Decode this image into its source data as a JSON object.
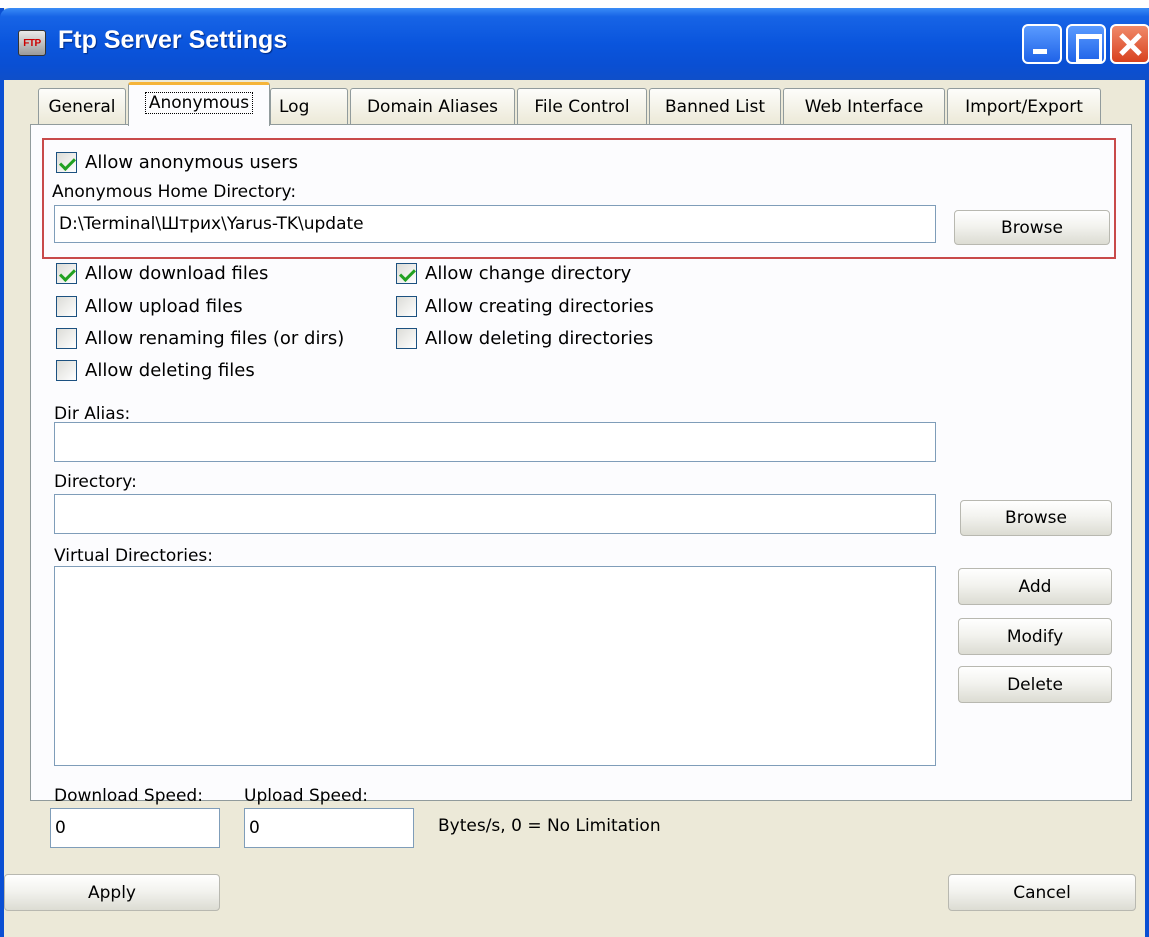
{
  "window": {
    "title": "Ftp Server Settings",
    "icon_text": "FTP"
  },
  "tabs": [
    {
      "label": "General"
    },
    {
      "label": "Anonymous"
    },
    {
      "label": "Log"
    },
    {
      "label": "Domain Aliases"
    },
    {
      "label": "File Control"
    },
    {
      "label": "Banned List"
    },
    {
      "label": "Web Interface"
    },
    {
      "label": "Import/Export"
    }
  ],
  "anonymous": {
    "allow_anonymous_label": "Allow anonymous users",
    "home_dir_label": "Anonymous Home Directory:",
    "home_dir_value": "D:\\Terminal\\Штрих\\Yarus-TK\\update",
    "browse_label": "Browse"
  },
  "permissions": {
    "download": "Allow download files",
    "upload": "Allow upload files",
    "renaming": "Allow renaming files (or dirs)",
    "deleting_files": "Allow deleting files",
    "change_dir": "Allow change directory",
    "creating_dirs": "Allow creating directories",
    "deleting_dirs": "Allow deleting directories"
  },
  "virtual": {
    "dir_alias_label": "Dir Alias:",
    "directory_label": "Directory:",
    "browse_label": "Browse",
    "list_label": "Virtual Directories:",
    "add_label": "Add",
    "modify_label": "Modify",
    "delete_label": "Delete"
  },
  "speed": {
    "download_label": "Download Speed:",
    "download_value": "0",
    "upload_label": "Upload Speed:",
    "upload_value": "0",
    "note": "Bytes/s, 0 = No Limitation"
  },
  "footer": {
    "apply_label": "Apply",
    "cancel_label": "Cancel"
  }
}
